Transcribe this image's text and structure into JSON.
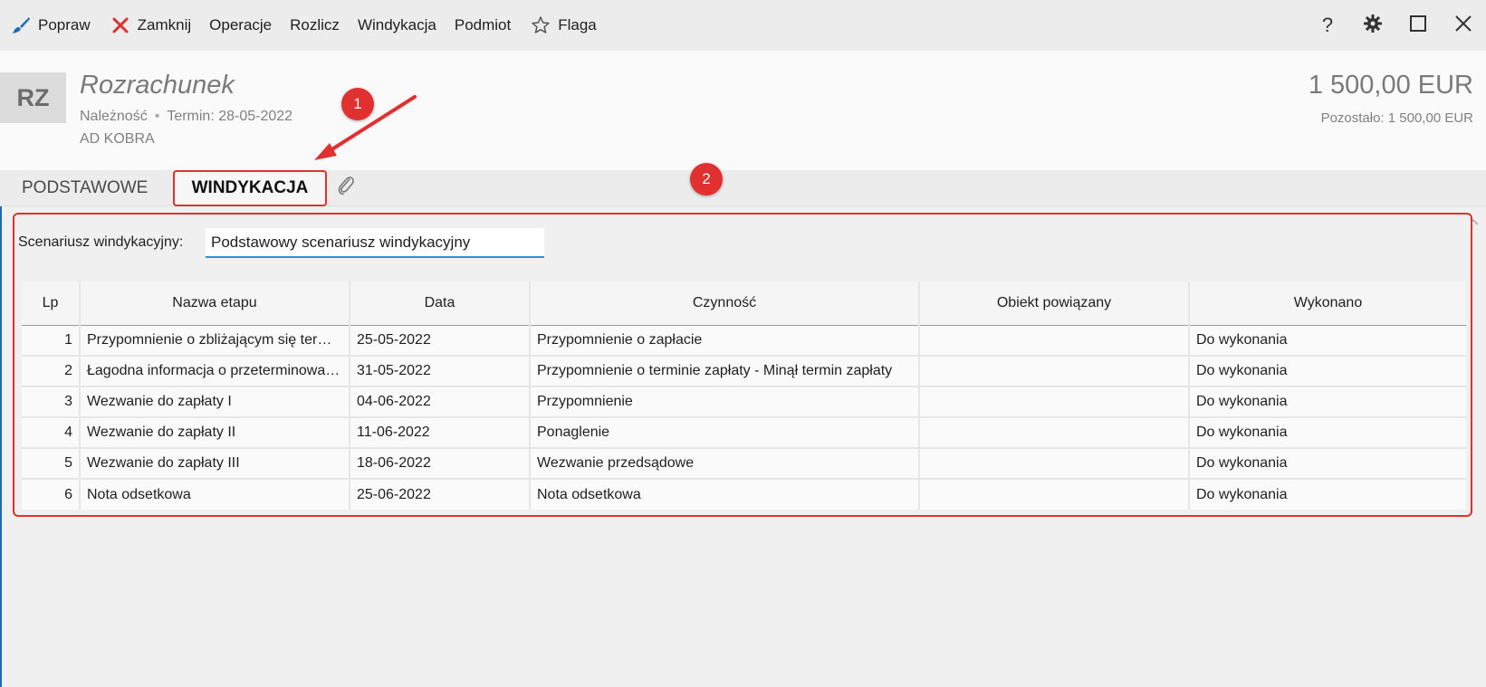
{
  "toolbar": {
    "items": [
      {
        "label": "Popraw",
        "icon": "brush-icon"
      },
      {
        "label": "Zamknij",
        "icon": "close-x-icon"
      },
      {
        "label": "Operacje"
      },
      {
        "label": "Rozlicz"
      },
      {
        "label": "Windykacja"
      },
      {
        "label": "Podmiot"
      },
      {
        "label": "Flaga",
        "icon": "star-outline-icon"
      }
    ],
    "window_buttons": [
      "help-icon",
      "settings-gear-icon",
      "maximize-icon",
      "close-window-icon"
    ],
    "help_label": "?"
  },
  "header": {
    "badge": "RZ",
    "title": "Rozrachunek",
    "type": "Należność",
    "separator": "•",
    "due": "Termin: 28-05-2022",
    "client": "AD KOBRA",
    "amount": "1 500,00 EUR",
    "remaining": "Pozostało: 1 500,00 EUR"
  },
  "tabs": {
    "basic": "PODSTAWOWE",
    "collection": "WINDYKACJA",
    "attachment_icon": "paperclip-icon"
  },
  "callouts": {
    "one": "1",
    "two": "2"
  },
  "colors": {
    "accent": "#e03030",
    "input_underline": "#2f8fd8",
    "brush": "#1e6bb8"
  },
  "scenario": {
    "label": "Scenariusz windykacyjny:",
    "value": "Podstawowy scenariusz windykacyjny"
  },
  "grid": {
    "columns": [
      "Lp",
      "Nazwa etapu",
      "Data",
      "Czynność",
      "Obiekt powiązany",
      "Wykonano"
    ],
    "rows": [
      {
        "lp": "1",
        "name": "Przypomnienie o zbliżającym się terminie zapłaty",
        "date": "25-05-2022",
        "action": "Przypomnienie o zapłacie",
        "related": "",
        "done": "Do wykonania"
      },
      {
        "lp": "2",
        "name": "Łagodna informacja o przeterminowaniu",
        "date": "31-05-2022",
        "action": "Przypomnienie o terminie zapłaty - Minął termin zapłaty",
        "related": "",
        "done": "Do wykonania"
      },
      {
        "lp": "3",
        "name": "Wezwanie do zapłaty I",
        "date": "04-06-2022",
        "action": "Przypomnienie",
        "related": "",
        "done": "Do wykonania"
      },
      {
        "lp": "4",
        "name": "Wezwanie do zapłaty II",
        "date": "11-06-2022",
        "action": "Ponaglenie",
        "related": "",
        "done": "Do wykonania"
      },
      {
        "lp": "5",
        "name": "Wezwanie do zapłaty III",
        "date": "18-06-2022",
        "action": "Wezwanie przedsądowe",
        "related": "",
        "done": "Do wykonania"
      },
      {
        "lp": "6",
        "name": "Nota odsetkowa",
        "date": "25-06-2022",
        "action": "Nota odsetkowa",
        "related": "",
        "done": "Do wykonania"
      }
    ]
  }
}
